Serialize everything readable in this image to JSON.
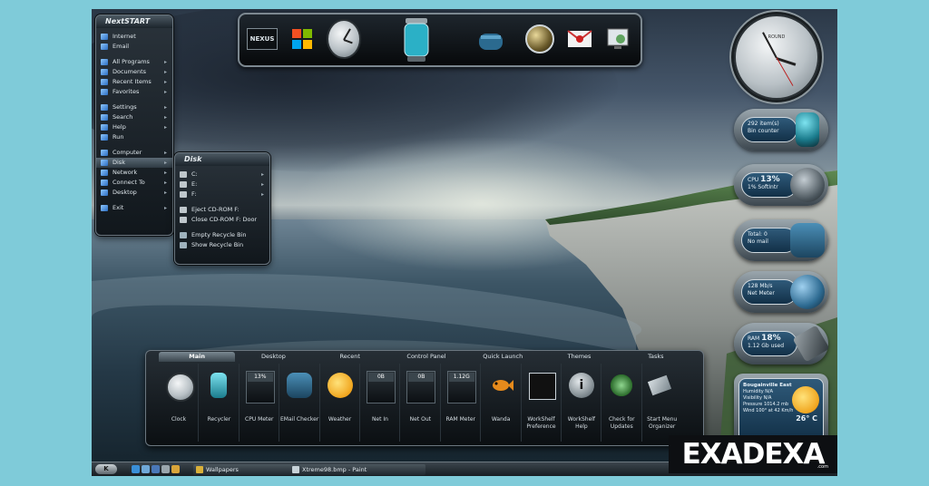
{
  "start_menu": {
    "title": "NextSTART",
    "items": [
      {
        "label": "Internet",
        "arrow": ""
      },
      {
        "label": "Email",
        "arrow": ""
      },
      {
        "label": "All Programs",
        "arrow": "▸"
      },
      {
        "label": "Documents",
        "arrow": "▸"
      },
      {
        "label": "Recent Items",
        "arrow": "▸"
      },
      {
        "label": "Favorites",
        "arrow": "▸"
      },
      {
        "label": "Settings",
        "arrow": "▸"
      },
      {
        "label": "Search",
        "arrow": "▸"
      },
      {
        "label": "Help",
        "arrow": "▸"
      },
      {
        "label": "Run",
        "arrow": ""
      },
      {
        "label": "Computer",
        "arrow": "▸"
      },
      {
        "label": "Disk",
        "arrow": "▸"
      },
      {
        "label": "Network",
        "arrow": "▸"
      },
      {
        "label": "Connect To",
        "arrow": "▸"
      },
      {
        "label": "Desktop",
        "arrow": "▸"
      },
      {
        "label": "Exit",
        "arrow": "▸"
      }
    ]
  },
  "disk_menu": {
    "title": "Disk",
    "items": [
      "C:",
      "E:",
      "F:",
      "Eject CD-ROM F:",
      "Close CD-ROM F: Door",
      "Empty Recycle Bin",
      "Show Recycle Bin"
    ]
  },
  "dock": {
    "icons": [
      "nexus-logo",
      "windows-logo",
      "clock",
      "recycler",
      "email-checker",
      "globe",
      "mail-pin",
      "monitor-settings"
    ],
    "nexus_label": "NEXUS"
  },
  "clock": {
    "label": "ROUND"
  },
  "side_gadgets": [
    {
      "line1": "292 item(s)",
      "line2": "Bin counter"
    },
    {
      "line1": "CPU",
      "value": "13%",
      "line2": "1% SoftIntr"
    },
    {
      "line1": "Total: 0",
      "line2": "No mail"
    },
    {
      "line1": "128 Mb/s",
      "line2": "Net Meter"
    },
    {
      "line1": "RAM",
      "value": "18%",
      "line2": "1.12 Gb used"
    }
  ],
  "weather": {
    "location": "Bougainville East",
    "humidity": "Humidity N/A",
    "visibility": "Visibility N/A",
    "pressure": "Pressure 1014.2 mb",
    "wind": "Wind 100° at 42 Km/h",
    "temperature": "26° C"
  },
  "task_panel": {
    "tabs": [
      "Main",
      "Desktop",
      "Recent",
      "Control Panel",
      "Quick Launch",
      "Themes",
      "Tasks"
    ],
    "active_tab": "Main",
    "items": [
      {
        "label": "Clock"
      },
      {
        "label": "Recycler"
      },
      {
        "label": "CPU Meter",
        "value": "13%"
      },
      {
        "label": "EMail Checker"
      },
      {
        "label": "Weather"
      },
      {
        "label": "Net In",
        "value": "0B"
      },
      {
        "label": "Net Out",
        "value": "0B"
      },
      {
        "label": "RAM Meter",
        "value": "1.12G"
      },
      {
        "label": "Wanda"
      },
      {
        "label": "WorkShelf Preference"
      },
      {
        "label": "WorkShelf Help"
      },
      {
        "label": "Check for Updates"
      },
      {
        "label": "Start Menu Organizer"
      }
    ]
  },
  "taskbar": {
    "start_label": "K",
    "tasks": [
      "Wallpapers",
      "Xtreme98.bmp - Paint"
    ]
  },
  "logo": {
    "text": "EXADEXA",
    "small": ".com"
  }
}
